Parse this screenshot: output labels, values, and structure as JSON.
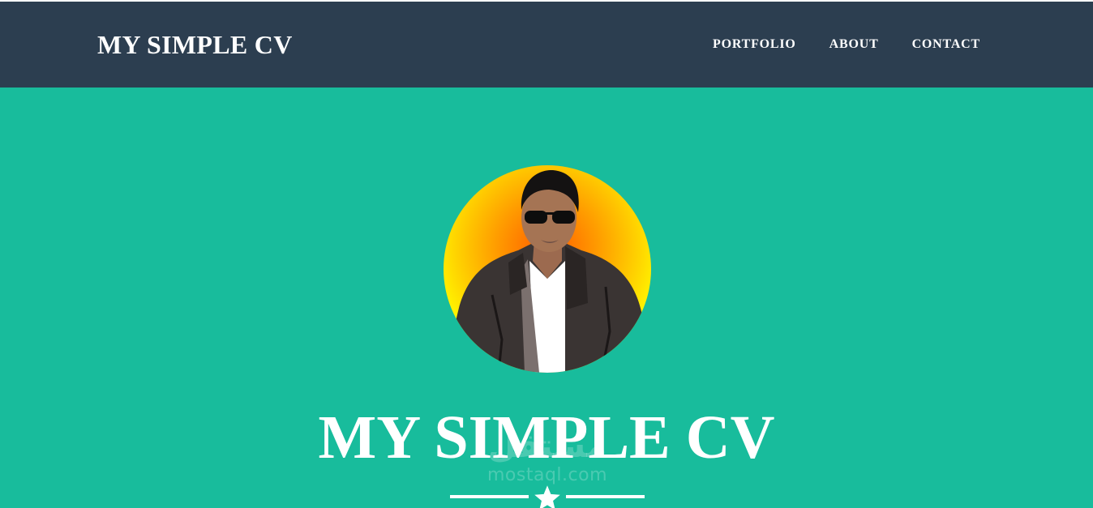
{
  "navbar": {
    "brand": "MY SIMPLE CV",
    "links": [
      {
        "label": "PORTFOLIO"
      },
      {
        "label": "ABOUT"
      },
      {
        "label": "CONTACT"
      }
    ]
  },
  "hero": {
    "title": "MY SIMPLE CV",
    "divider_icon": "star-icon"
  },
  "watermark": {
    "arabic": "مستقل",
    "latin": "mostaql.com"
  },
  "colors": {
    "navbar": "#2c3e50",
    "hero": "#18bc9c",
    "text": "#ffffff",
    "avatar_glow_inner": "#ff5b00",
    "avatar_glow_outer": "#ffff00"
  }
}
